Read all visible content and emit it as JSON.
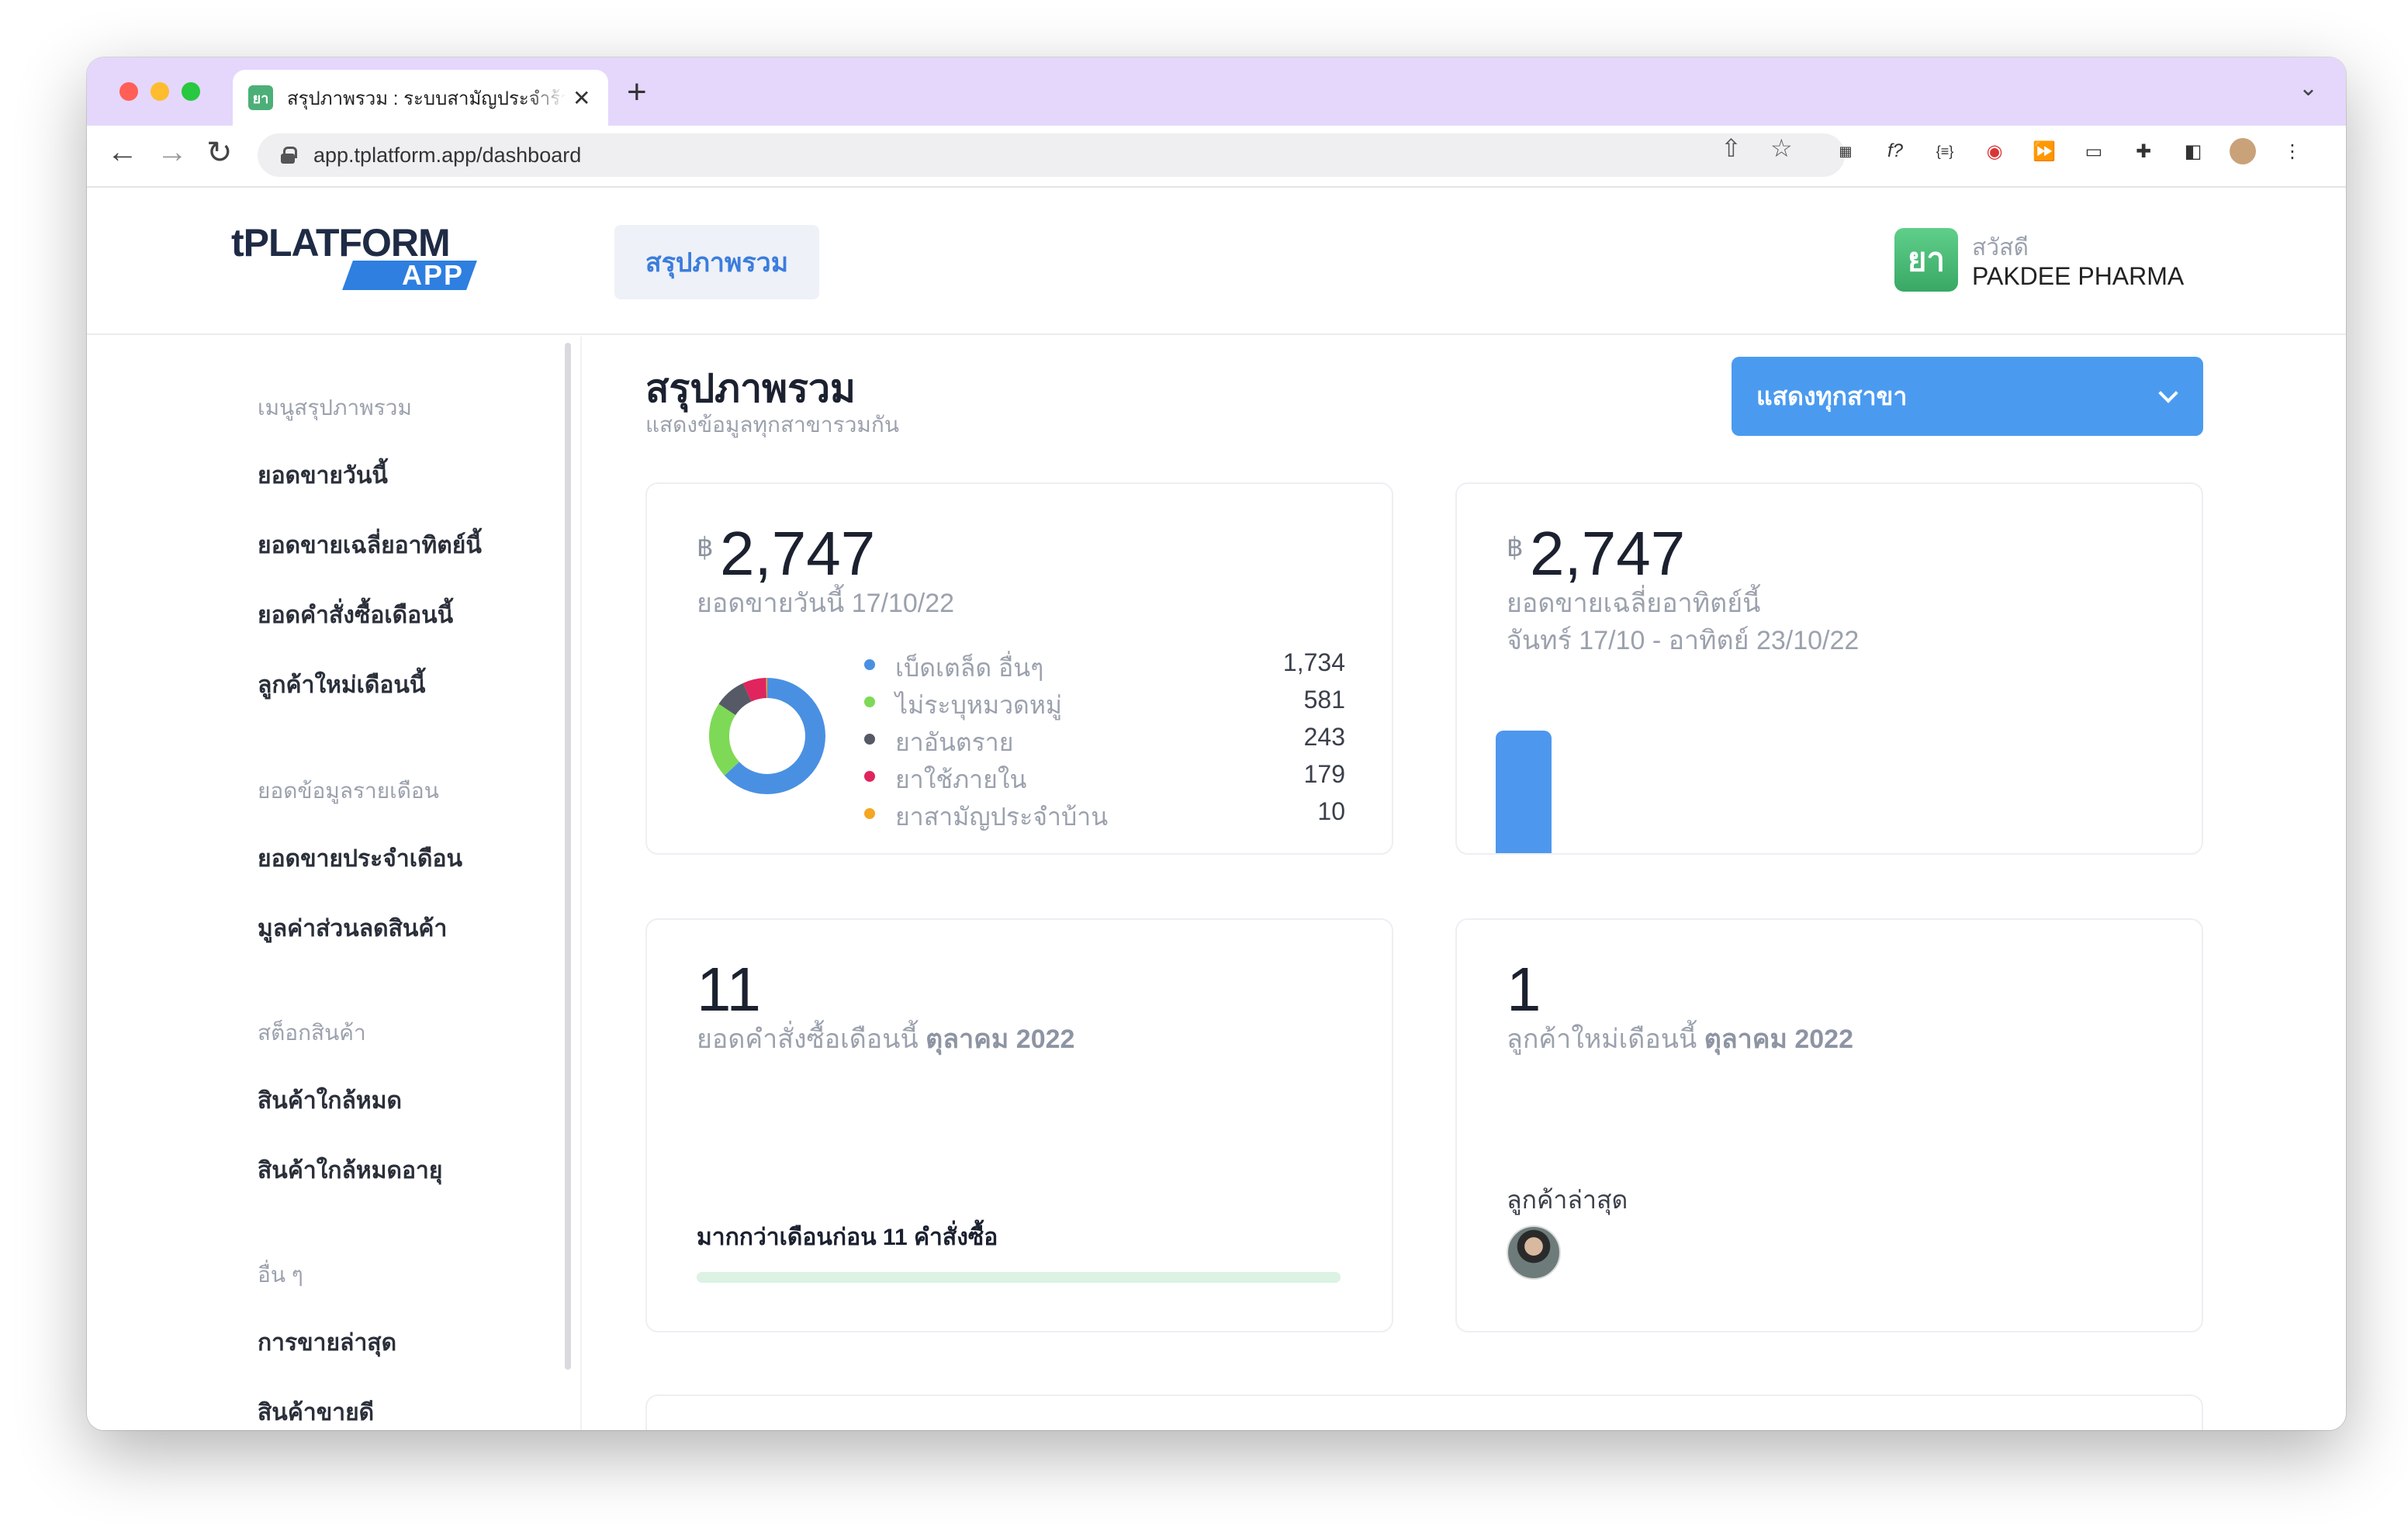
{
  "browser": {
    "tab_title": "สรุปภาพรวม : ระบบสามัญประจำร้าน",
    "tab_favicon_text": "ยา",
    "url": "app.tplatform.app/dashboard",
    "new_tab_symbol": "+",
    "close_symbol": "✕"
  },
  "header": {
    "logo_top": "tPLATFORM",
    "logo_bottom": "APP",
    "nav_tab": "สรุปภาพรวม",
    "user_badge": "ยา",
    "greeting": "สวัสดี",
    "user_name": "PAKDEE PHARMA"
  },
  "sidebar": {
    "groups": [
      {
        "heading": "เมนูสรุปภาพรวม",
        "items": [
          "ยอดขายวันนี้",
          "ยอดขายเฉลี่ยอาทิตย์นี้",
          "ยอดคำสั่งซื้อเดือนนี้",
          "ลูกค้าใหม่เดือนนี้"
        ]
      },
      {
        "heading": "ยอดข้อมูลรายเดือน",
        "items": [
          "ยอดขายประจำเดือน",
          "มูลค่าส่วนลดสินค้า"
        ]
      },
      {
        "heading": "สต็อกสินค้า",
        "items": [
          "สินค้าใกล้หมด",
          "สินค้าใกล้หมดอายุ"
        ]
      },
      {
        "heading": "อื่น ๆ",
        "items": [
          "การขายล่าสุด",
          "สินค้าขายดี"
        ]
      }
    ]
  },
  "main": {
    "title": "สรุปภาพรวม",
    "subtitle": "แสดงข้อมูลทุกสาขารวมกัน",
    "branch_select": "แสดงทุกสาขา",
    "currency": "฿",
    "today": {
      "value": "2,747",
      "label": "ยอดขายวันนี้ 17/10/22",
      "legend": [
        {
          "label": "เบ็ดเตล็ด อื่นๆ",
          "value": "1,734",
          "color": "#4a90e2"
        },
        {
          "label": "ไม่ระบุหมวดหมู่",
          "value": "581",
          "color": "#7ed957"
        },
        {
          "label": "ยาอันตราย",
          "value": "243",
          "color": "#555a66"
        },
        {
          "label": "ยาใช้ภายใน",
          "value": "179",
          "color": "#e0245e"
        },
        {
          "label": "ยาสามัญประจำบ้าน",
          "value": "10",
          "color": "#f5a623"
        }
      ]
    },
    "week": {
      "value": "2,747",
      "label_line1": "ยอดขายเฉลี่ยอาทิตย์นี้",
      "label_line2": "จันทร์ 17/10 - อาทิตย์ 23/10/22"
    },
    "orders": {
      "value": "11",
      "label": "ยอดคำสั่งซื้อเดือนนี้",
      "label_strong": "ตุลาคม 2022",
      "progress_text": "มากกว่าเดือนก่อน 11 คำสั่งซื้อ",
      "progress_ratio": 1.0
    },
    "customers": {
      "value": "1",
      "label": "ลูกค้าใหม่เดือนนี้",
      "label_strong": "ตุลาคม 2022",
      "recent_label": "ลูกค้าล่าสุด"
    }
  },
  "chart_data": [
    {
      "type": "pie",
      "categories": [
        "เบ็ดเตล็ด อื่นๆ",
        "ไม่ระบุหมวดหมู่",
        "ยาอันตราย",
        "ยาใช้ภายใน",
        "ยาสามัญประจำบ้าน"
      ],
      "values": [
        1734,
        581,
        243,
        179,
        10
      ],
      "colors": [
        "#4a90e2",
        "#7ed957",
        "#555a66",
        "#e0245e",
        "#f5a623"
      ],
      "title": "",
      "legend": "right"
    },
    {
      "type": "bar",
      "categories": [
        "จันทร์ 17/10"
      ],
      "values": [
        2747
      ],
      "title": "",
      "xlabel": "",
      "ylabel": ""
    }
  ]
}
